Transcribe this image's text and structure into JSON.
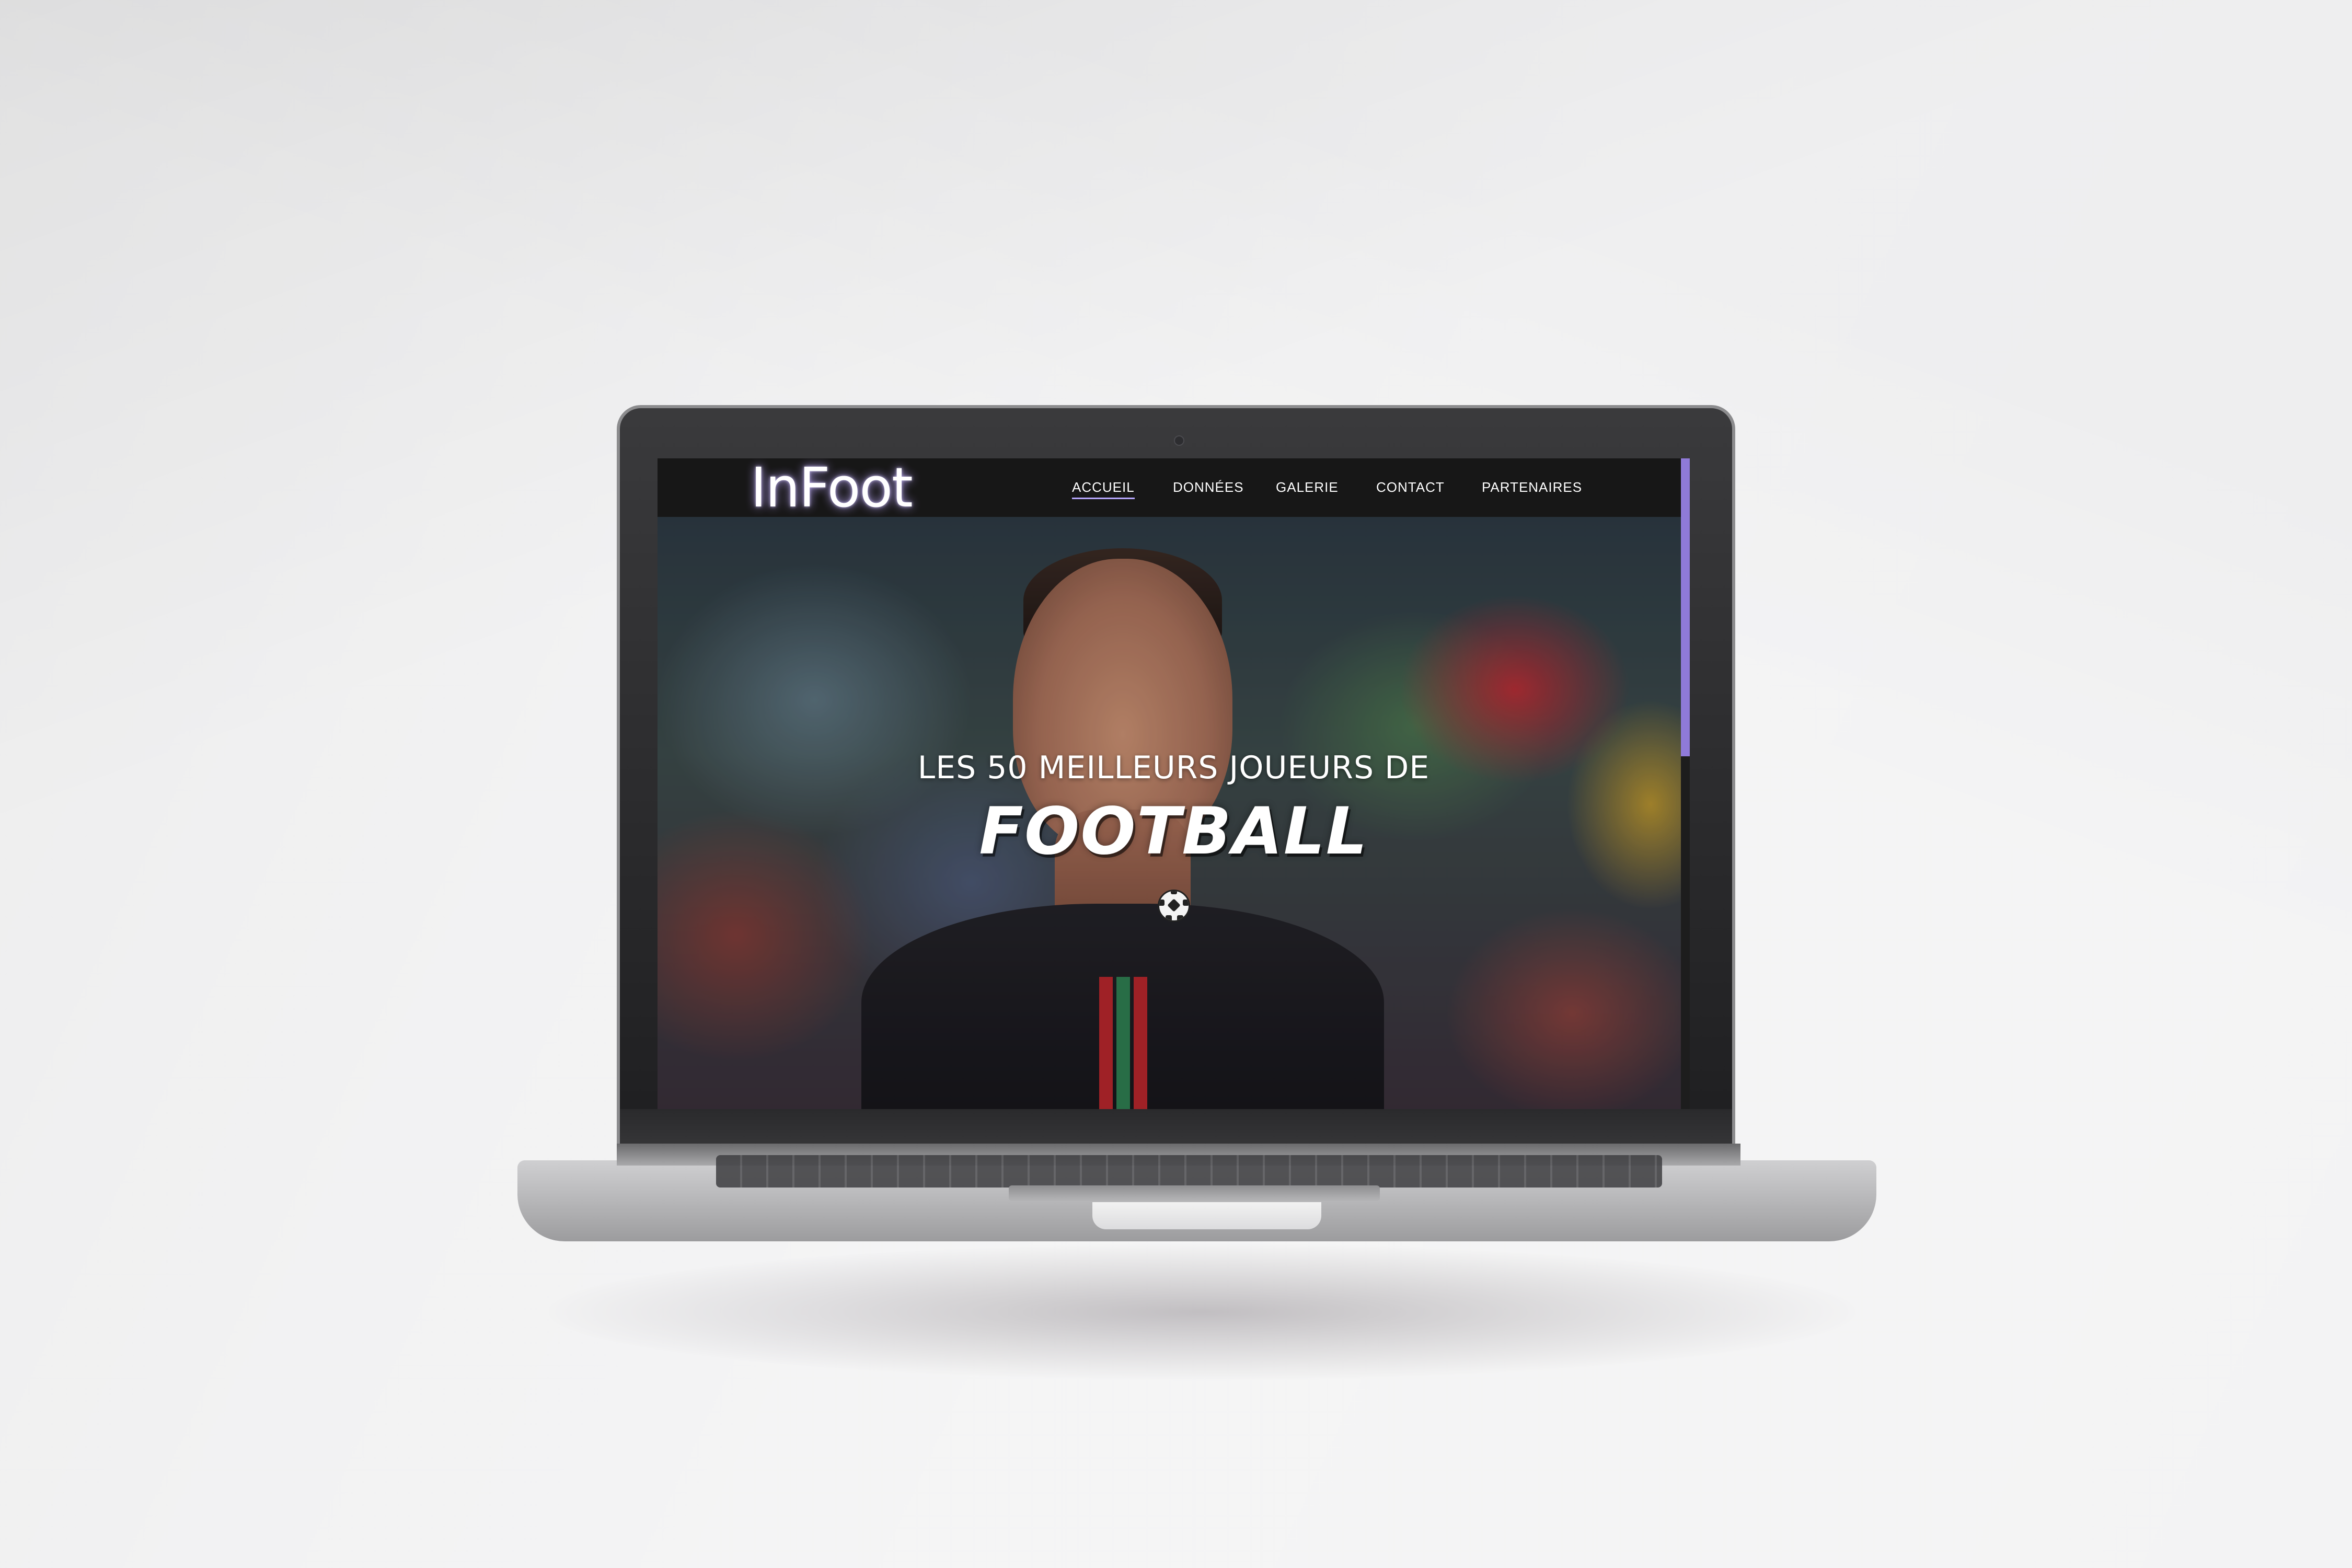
{
  "site": {
    "logo": "InFoot",
    "nav": [
      {
        "label": "ACCUEIL",
        "active": true
      },
      {
        "label": "DONNÉES",
        "active": false
      },
      {
        "label": "GALERIE",
        "active": false
      },
      {
        "label": "CONTACT",
        "active": false
      },
      {
        "label": "PARTENAIRES",
        "active": false
      }
    ]
  },
  "hero": {
    "subtitle": "LES 50 MEILLEURS JOUEURS DE",
    "title": "FOOTBALL",
    "icon": "soccer-ball-icon"
  },
  "colors": {
    "navbar": "#171717",
    "accent": "#8f7ad8",
    "text": "#ffffff"
  },
  "scrollbar": {
    "scroll_position": 0
  }
}
